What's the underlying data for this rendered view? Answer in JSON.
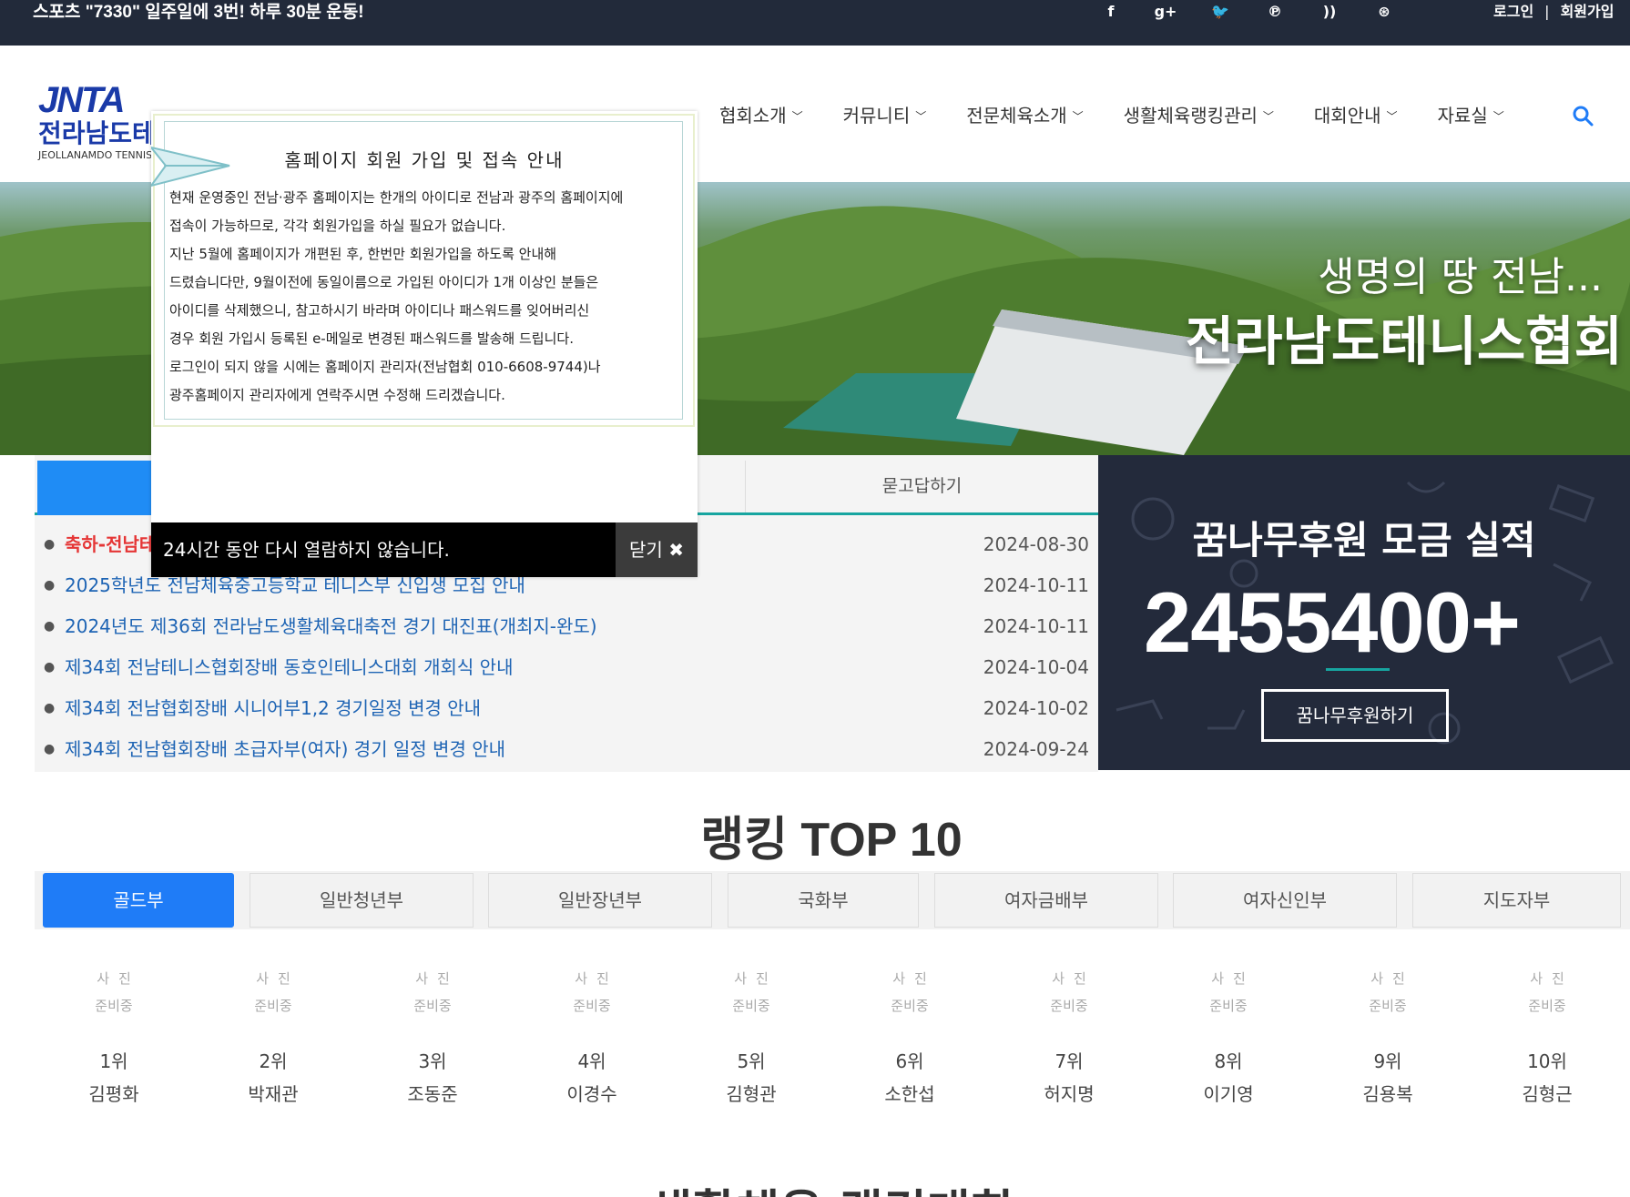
{
  "topbar": {
    "slogan": "스포츠 \"7330\" 일주일에 3번! 하루 30분 운동!",
    "social": [
      {
        "icon": "facebook-icon",
        "glyph": "f"
      },
      {
        "icon": "google-plus-icon",
        "glyph": "g+"
      },
      {
        "icon": "twitter-icon",
        "glyph": "🐦"
      },
      {
        "icon": "pinterest-icon",
        "glyph": "℗"
      },
      {
        "icon": "rss-icon",
        "glyph": "))"
      },
      {
        "icon": "dribbble-icon",
        "glyph": "⊛"
      }
    ],
    "login": "로그인",
    "separator": "|",
    "signup": "회원가입"
  },
  "logo": {
    "mark": "JNTA",
    "name": "전라남도테니스협회",
    "sub": "JEOLLANAMDO TENNIS"
  },
  "nav": {
    "items": [
      "협회소개",
      "커뮤니티",
      "전문체육소개",
      "생활체육랭킹관리",
      "대회안내",
      "자료실"
    ]
  },
  "banner": {
    "line1": "생명의 땅 전남...",
    "line2": "전라남도테니스협회"
  },
  "notice": {
    "qa_tab": "묻고답하기",
    "items": [
      {
        "title": "축하-전남테",
        "date": "2024-08-30",
        "highlight": true
      },
      {
        "title": "2025학년도 전남체육중고등학교 테니스부 신입생 모집 안내",
        "date": "2024-10-11",
        "highlight": false
      },
      {
        "title": "2024년도 제36회 전라남도생활체육대축전 경기 대진표(개최지-완도)",
        "date": "2024-10-11",
        "highlight": false
      },
      {
        "title": "제34회 전남테니스협회장배 동호인테니스대회 개회식 안내",
        "date": "2024-10-04",
        "highlight": false
      },
      {
        "title": "제34회 전남협회장배 시니어부1,2 경기일정 변경 안내",
        "date": "2024-10-02",
        "highlight": false
      },
      {
        "title": "제34회 전남협회장배 초급자부(여자) 경기 일정 변경 안내",
        "date": "2024-09-24",
        "highlight": false
      }
    ]
  },
  "donate": {
    "title": "꿈나무후원 모금 실적",
    "amount": "2455400",
    "plus": "+",
    "button": "꿈나무후원하기"
  },
  "ranking": {
    "title": "랭킹 TOP 10",
    "tabs": [
      "골드부",
      "일반청년부",
      "일반장년부",
      "국화부",
      "여자금배부",
      "여자신인부",
      "지도자부"
    ],
    "active_tab": 0,
    "photo_placeholder_1": "사진",
    "photo_placeholder_2": "준비중",
    "players": [
      {
        "rank": "1위",
        "name": "김평화"
      },
      {
        "rank": "2위",
        "name": "박재관"
      },
      {
        "rank": "3위",
        "name": "조동준"
      },
      {
        "rank": "4위",
        "name": "이경수"
      },
      {
        "rank": "5위",
        "name": "김형관"
      },
      {
        "rank": "6위",
        "name": "소한섭"
      },
      {
        "rank": "7위",
        "name": "허지명"
      },
      {
        "rank": "8위",
        "name": "이기영"
      },
      {
        "rank": "9위",
        "name": "김용복"
      },
      {
        "rank": "10위",
        "name": "김형근"
      }
    ]
  },
  "bottom_title": "생활체육 랭킹대회",
  "popup": {
    "title": "홈페이지 회원 가입 및 접속 안내",
    "lines": [
      "현재 운영중인 전남·광주 홈페이지는 한개의 아이디로 전남과 광주의 홈페이지에",
      " 접속이 가능하므로, 각각 회원가입을 하실 필요가 없습니다.",
      "지난 5월에 홈페이지가 개편된 후, 한번만 회원가입을 하도록 안내해",
      "드렸습니다만, 9월이전에 동일이름으로 가입된 아이디가 1개 이상인 분들은",
      " 아이디를 삭제했으니, 참고하시기 바라며 아이디나 패스워드를 잊어버리신",
      "  경우 회원 가입시 등록된 e-메일로 변경된 패스워드를 발송해 드립니다.",
      "로그인이 되지 않을 시에는 홈페이지 관리자(전남협회 010-6608-9744)나",
      "광주홈페이지 관리자에게 연락주시면 수정해 드리겠습니다."
    ],
    "no_show": "24시간 동안 다시 열람하지 않습니다.",
    "close": "닫기 ✖"
  }
}
